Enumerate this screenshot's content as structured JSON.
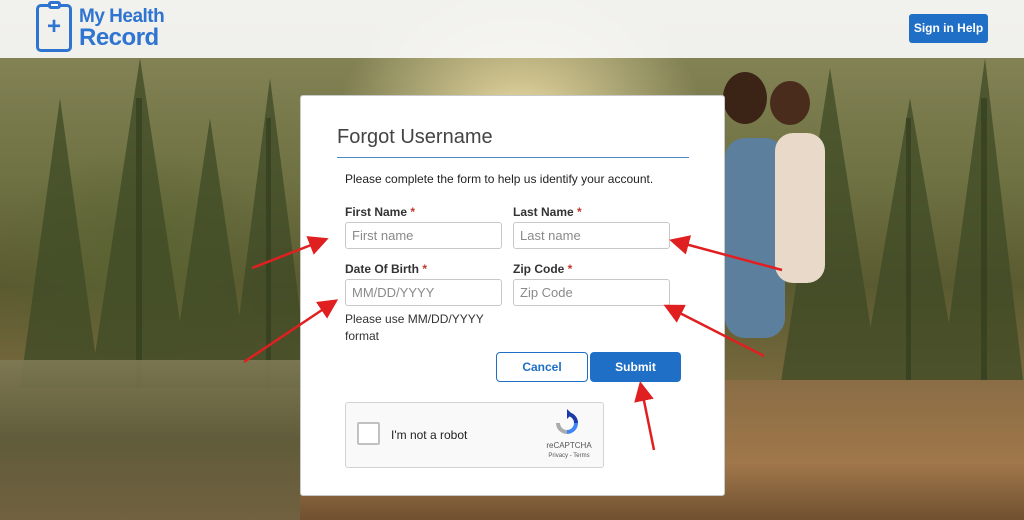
{
  "header": {
    "logo_line1": "My Health",
    "logo_line2": "Record",
    "help_button": "Sign in Help"
  },
  "form": {
    "title": "Forgot Username",
    "intro": "Please complete the form to help us identify your account.",
    "first_name": {
      "label": "First Name",
      "required": "*",
      "placeholder": "First name",
      "value": ""
    },
    "last_name": {
      "label": "Last Name",
      "required": "*",
      "placeholder": "Last name",
      "value": ""
    },
    "dob": {
      "label": "Date Of Birth",
      "required": "*",
      "placeholder": "MM/DD/YYYY",
      "value": ""
    },
    "zip": {
      "label": "Zip Code",
      "required": "*",
      "placeholder": "Zip Code",
      "value": ""
    },
    "dob_hint": "Please use MM/DD/YYYY format",
    "cancel_label": "Cancel",
    "submit_label": "Submit"
  },
  "captcha": {
    "label": "I'm not a robot",
    "brand": "reCAPTCHA",
    "links": "Privacy - Terms"
  },
  "colors": {
    "accent": "#1f6fc6",
    "logo": "#2f74d0",
    "annotation_arrow": "#e02020"
  }
}
